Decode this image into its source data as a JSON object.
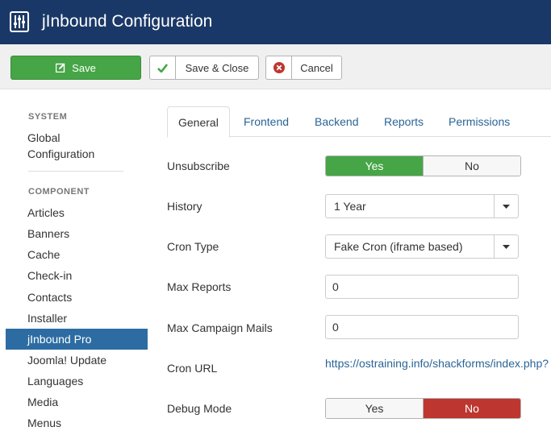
{
  "header": {
    "title": "jInbound Configuration"
  },
  "toolbar": {
    "save_label": "Save",
    "save_close_label": "Save & Close",
    "cancel_label": "Cancel"
  },
  "sidebar": {
    "system_heading": "SYSTEM",
    "global_config": [
      "Global",
      "Configuration"
    ],
    "component_heading": "COMPONENT",
    "items": [
      "Articles",
      "Banners",
      "Cache",
      "Check-in",
      "Contacts",
      "Installer",
      "jInbound Pro",
      "Joomla! Update",
      "Languages",
      "Media",
      "Menus"
    ],
    "active_item": "jInbound Pro"
  },
  "tabs": [
    "General",
    "Frontend",
    "Backend",
    "Reports",
    "Permissions"
  ],
  "active_tab": "General",
  "form": {
    "unsubscribe": {
      "label": "Unsubscribe",
      "yes": "Yes",
      "no": "No",
      "value": "Yes"
    },
    "history": {
      "label": "History",
      "value": "1 Year"
    },
    "cron_type": {
      "label": "Cron Type",
      "value": "Fake Cron (iframe based)"
    },
    "max_reports": {
      "label": "Max Reports",
      "value": "0"
    },
    "max_campaign_mails": {
      "label": "Max Campaign Mails",
      "value": "0"
    },
    "cron_url": {
      "label": "Cron URL",
      "value": "https://ostraining.info/shackforms/index.php?"
    },
    "debug_mode": {
      "label": "Debug Mode",
      "yes": "Yes",
      "no": "No",
      "value": "No"
    }
  },
  "colors": {
    "header": "#1a3867",
    "success": "#46a546",
    "danger": "#bd362f",
    "active_nav": "#2d6ca2",
    "link": "#2a6496"
  }
}
